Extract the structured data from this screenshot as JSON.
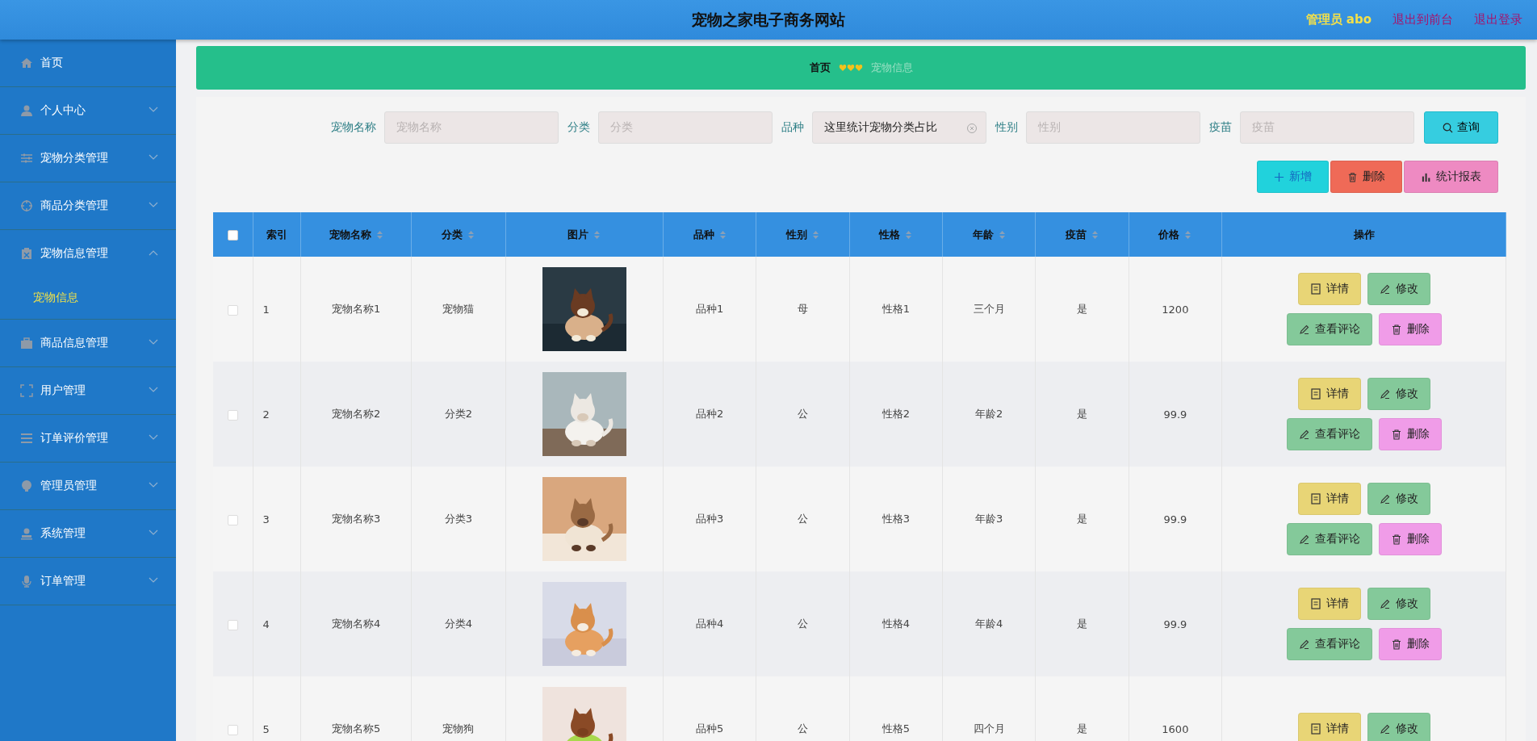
{
  "header": {
    "title": "宠物之家电子商务网站",
    "user": "管理员 abo",
    "links": [
      "退出到前台",
      "退出登录"
    ]
  },
  "sidebar": {
    "items": [
      {
        "label": "首页"
      },
      {
        "label": "个人中心",
        "expanded": false
      },
      {
        "label": "宠物分类管理",
        "expanded": false
      },
      {
        "label": "商品分类管理",
        "expanded": false
      },
      {
        "label": "宠物信息管理",
        "expanded": true,
        "children": [
          {
            "label": "宠物信息",
            "selected": true
          }
        ]
      },
      {
        "label": "商品信息管理",
        "expanded": false
      },
      {
        "label": "用户管理",
        "expanded": false
      },
      {
        "label": "订单评价管理",
        "expanded": false
      },
      {
        "label": "管理员管理",
        "expanded": false
      },
      {
        "label": "系统管理",
        "expanded": false
      },
      {
        "label": "订单管理",
        "expanded": false
      }
    ]
  },
  "breadcrumb": [
    {
      "label": "首页"
    },
    {
      "label": "宠物信息"
    }
  ],
  "filters": [
    {
      "label": "宠物名称",
      "placeholder": "宠物名称"
    },
    {
      "label": "分类",
      "placeholder": "分类"
    },
    {
      "label": "品种",
      "value": "这里统计宠物分类占比"
    },
    {
      "label": "性别",
      "placeholder": "性别"
    },
    {
      "label": "疫苗",
      "placeholder": "疫苗"
    }
  ],
  "search_button": "查询",
  "toolbar": [
    {
      "label": "新增",
      "kind": "add"
    },
    {
      "label": "删除",
      "kind": "delete"
    },
    {
      "label": "统计报表",
      "kind": "report"
    }
  ],
  "table": {
    "select_all": {
      "checked": false
    },
    "columns": [
      {
        "label": "索引",
        "sortable": false
      },
      {
        "label": "宠物名称",
        "sortable": true
      },
      {
        "label": "分类",
        "sortable": true
      },
      {
        "label": "图片",
        "sortable": true
      },
      {
        "label": "品种",
        "sortable": true
      },
      {
        "label": "性别",
        "sortable": true
      },
      {
        "label": "性格",
        "sortable": true
      },
      {
        "label": "年龄",
        "sortable": true
      },
      {
        "label": "疫苗",
        "sortable": true
      },
      {
        "label": "价格",
        "sortable": true
      },
      {
        "label": "操作",
        "sortable": false
      }
    ],
    "rows": [
      {
        "selected": false,
        "cells": [
          "1",
          "宠物名称1",
          "宠物猫",
          {
            "kind": "picture"
          },
          "品种1",
          "母",
          "性格1",
          "三个月",
          "是",
          "1200"
        ],
        "actions": [
          {
            "label": "详情",
            "kind": "detail"
          },
          {
            "label": "修改",
            "kind": "edit"
          },
          {
            "label": "查看评论",
            "kind": "comments"
          },
          {
            "label": "删除",
            "kind": "delete"
          }
        ]
      },
      {
        "selected": false,
        "cells": [
          "2",
          "宠物名称2",
          "分类2",
          {
            "kind": "picture"
          },
          "品种2",
          "公",
          "性格2",
          "年龄2",
          "是",
          "99.9"
        ],
        "actions": [
          {
            "label": "详情",
            "kind": "detail"
          },
          {
            "label": "修改",
            "kind": "edit"
          },
          {
            "label": "查看评论",
            "kind": "comments"
          },
          {
            "label": "删除",
            "kind": "delete"
          }
        ]
      },
      {
        "selected": false,
        "cells": [
          "3",
          "宠物名称3",
          "分类3",
          {
            "kind": "picture"
          },
          "品种3",
          "公",
          "性格3",
          "年龄3",
          "是",
          "99.9"
        ],
        "actions": [
          {
            "label": "详情",
            "kind": "detail"
          },
          {
            "label": "修改",
            "kind": "edit"
          },
          {
            "label": "查看评论",
            "kind": "comments"
          },
          {
            "label": "删除",
            "kind": "delete"
          }
        ]
      },
      {
        "selected": false,
        "cells": [
          "4",
          "宠物名称4",
          "分类4",
          {
            "kind": "picture"
          },
          "品种4",
          "公",
          "性格4",
          "年龄4",
          "是",
          "99.9"
        ],
        "actions": [
          {
            "label": "详情",
            "kind": "detail"
          },
          {
            "label": "修改",
            "kind": "edit"
          },
          {
            "label": "查看评论",
            "kind": "comments"
          },
          {
            "label": "删除",
            "kind": "delete"
          }
        ]
      },
      {
        "selected": false,
        "cells": [
          "5",
          "宠物名称5",
          "宠物狗",
          {
            "kind": "picture"
          },
          "品种5",
          "公",
          "性格5",
          "四个月",
          "是",
          "1600"
        ],
        "actions": [
          {
            "label": "详情",
            "kind": "detail"
          },
          {
            "label": "修改",
            "kind": "edit"
          }
        ]
      }
    ]
  }
}
